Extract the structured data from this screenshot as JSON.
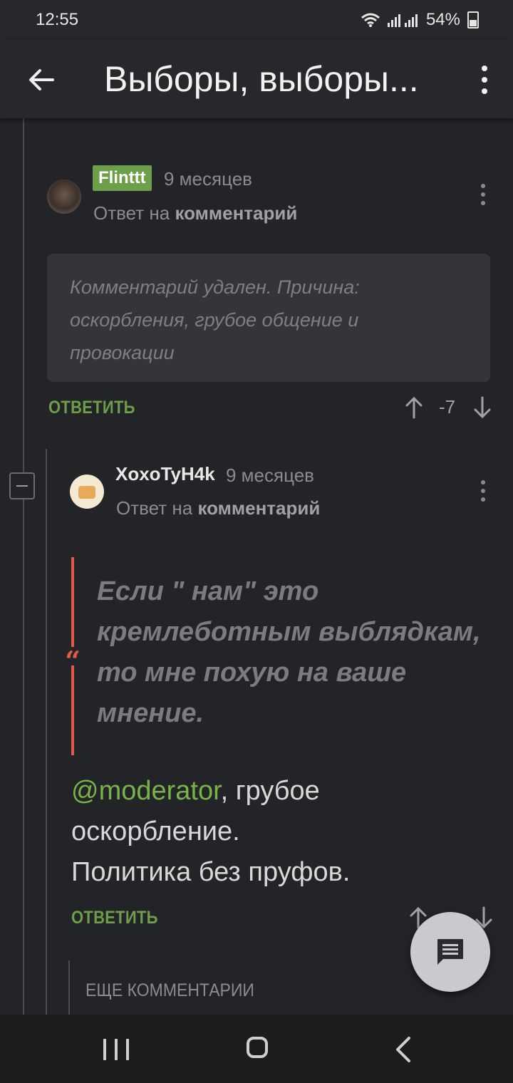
{
  "status_bar": {
    "time": "12:55",
    "battery_percent": "54%"
  },
  "app_bar": {
    "title": "Выборы, выборы..."
  },
  "comments": [
    {
      "username": "Flinttt",
      "time": "9 месяцев",
      "reply_prefix": "Ответ на",
      "reply_target": "комментарий",
      "deleted_text": "Комментарий удален. Причина: оскорбления, грубое общение и провокации",
      "reply_label": "ОТВЕТИТЬ",
      "score": "-7"
    },
    {
      "username": "XoxoTyH4k",
      "time": "9 месяцев",
      "reply_prefix": "Ответ на",
      "reply_target": "комментарий",
      "quote": "Если \" нам\" это кремлеботным выблядкам, то мне похую на ваше мнение.",
      "mention": "@moderator",
      "body_line1": ", грубое оскорбление.",
      "body_line2": "Политика без пруфов.",
      "reply_label": "ОТВЕТИТЬ"
    }
  ],
  "more_comments_label": "ЕЩЕ КОММЕНТАРИИ",
  "colors": {
    "accent": "#6d9e4a",
    "quote": "#e05b4b",
    "background": "#222427"
  }
}
